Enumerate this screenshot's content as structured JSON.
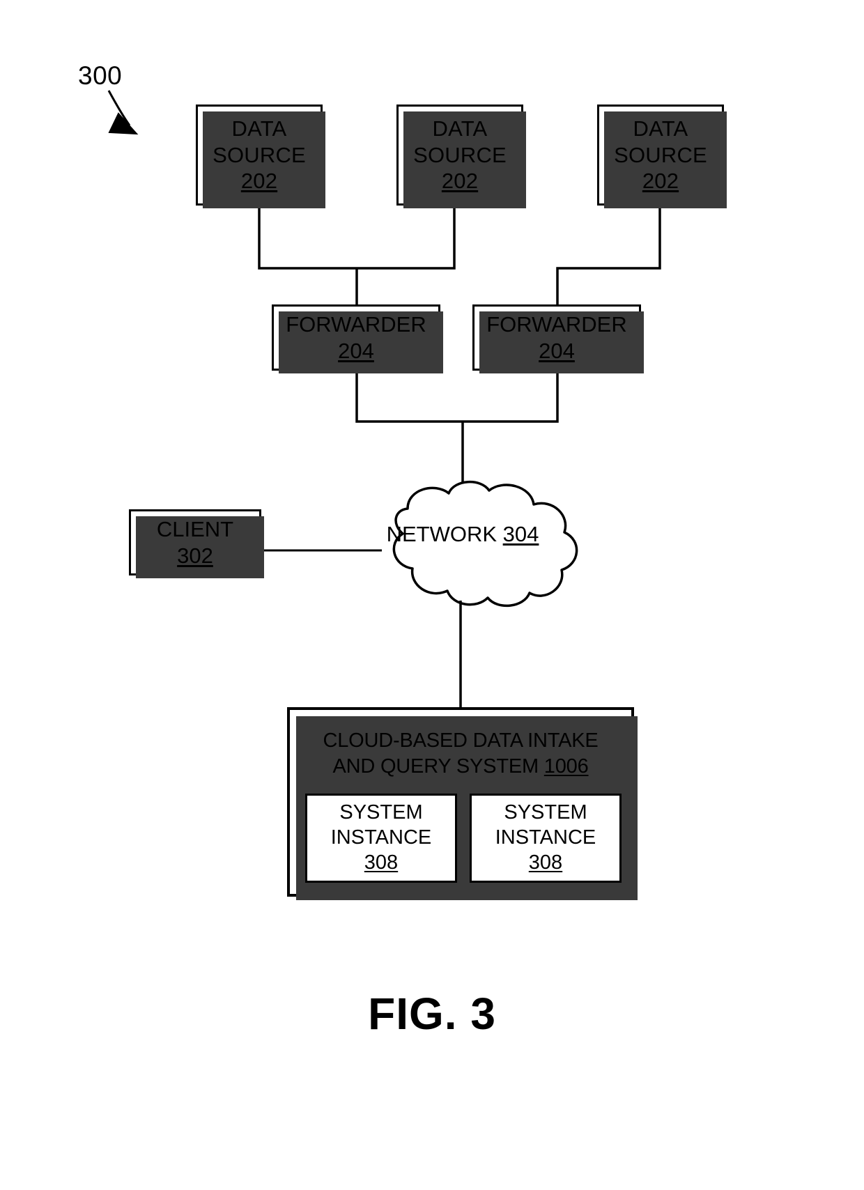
{
  "figure": {
    "lead_label": "300",
    "caption": "FIG. 3"
  },
  "nodes": {
    "data_sources": [
      {
        "line1": "DATA",
        "line2": "SOURCE",
        "ref": "202"
      },
      {
        "line1": "DATA",
        "line2": "SOURCE",
        "ref": "202"
      },
      {
        "line1": "DATA",
        "line2": "SOURCE",
        "ref": "202"
      }
    ],
    "forwarders": [
      {
        "line1": "FORWARDER",
        "ref": "204"
      },
      {
        "line1": "FORWARDER",
        "ref": "204"
      }
    ],
    "client": {
      "line1": "CLIENT",
      "ref": "302"
    },
    "network": {
      "line1": "NETWORK",
      "ref": "304"
    },
    "cloud_system": {
      "title_line1": "CLOUD-BASED DATA INTAKE",
      "title_line2": "AND QUERY SYSTEM ",
      "ref": "1006",
      "instances": [
        {
          "line1": "SYSTEM",
          "line2": "INSTANCE",
          "ref": "308"
        },
        {
          "line1": "SYSTEM",
          "line2": "INSTANCE",
          "ref": "308"
        }
      ]
    }
  },
  "style": {
    "stroke": "#000000",
    "shadow": "#3a3a3a",
    "background": "#ffffff"
  }
}
